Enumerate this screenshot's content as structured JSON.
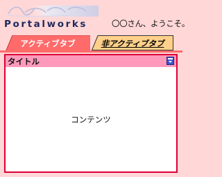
{
  "header": {
    "logo_text": "Portalworks",
    "welcome": "〇〇さん、ようこそ。"
  },
  "tabs": [
    {
      "label": "アクティブタブ",
      "active": true
    },
    {
      "label": "非アクティブタブ",
      "active": false
    }
  ],
  "panel": {
    "title": "タイトル",
    "content": "コンテンツ",
    "icon": "window-icon"
  },
  "colors": {
    "background": "#ffd7d7",
    "active_tab": "#ff6b6b",
    "inactive_tab": "#ffd08a",
    "panel_border": "#dd0033",
    "panel_header": "#ff99bb",
    "logo_text": "#1f2a5c"
  }
}
